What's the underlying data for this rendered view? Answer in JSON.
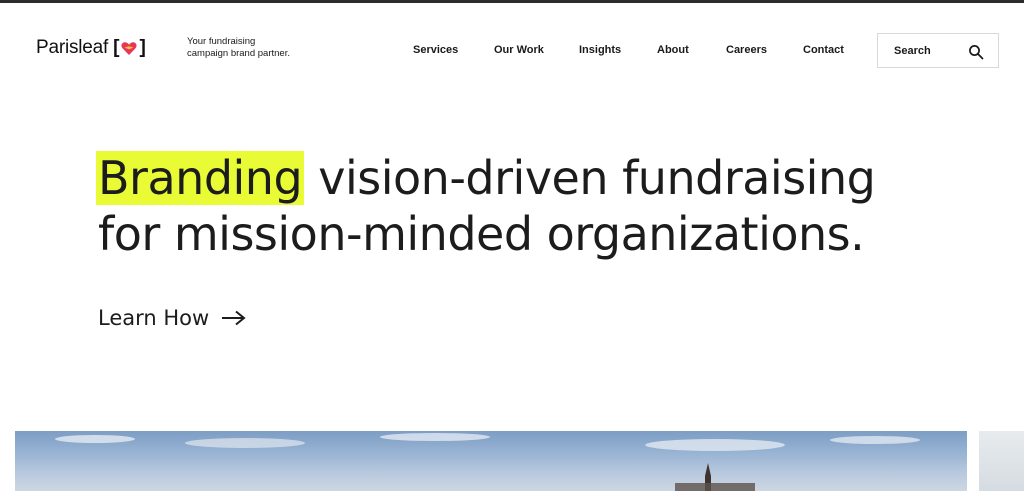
{
  "brand": {
    "name": "Parisleaf",
    "tagline_line1": "Your fundraising",
    "tagline_line2": "campaign brand partner.",
    "heart_color": "#e8365a",
    "wing_color": "#f2c230"
  },
  "nav": {
    "items": [
      {
        "label": "Services"
      },
      {
        "label": "Our Work"
      },
      {
        "label": "Insights"
      },
      {
        "label": "About"
      },
      {
        "label": "Careers"
      },
      {
        "label": "Contact"
      }
    ],
    "search_label": "Search",
    "search_icon": "search-icon"
  },
  "hero": {
    "headline_highlight": "Branding",
    "headline_rest_line1": " vision-driven fundraising",
    "headline_line2": "for mission-minded organizations.",
    "highlight_color": "#e8fb34",
    "cta_label": "Learn How",
    "cta_icon": "arrow-right-icon"
  }
}
